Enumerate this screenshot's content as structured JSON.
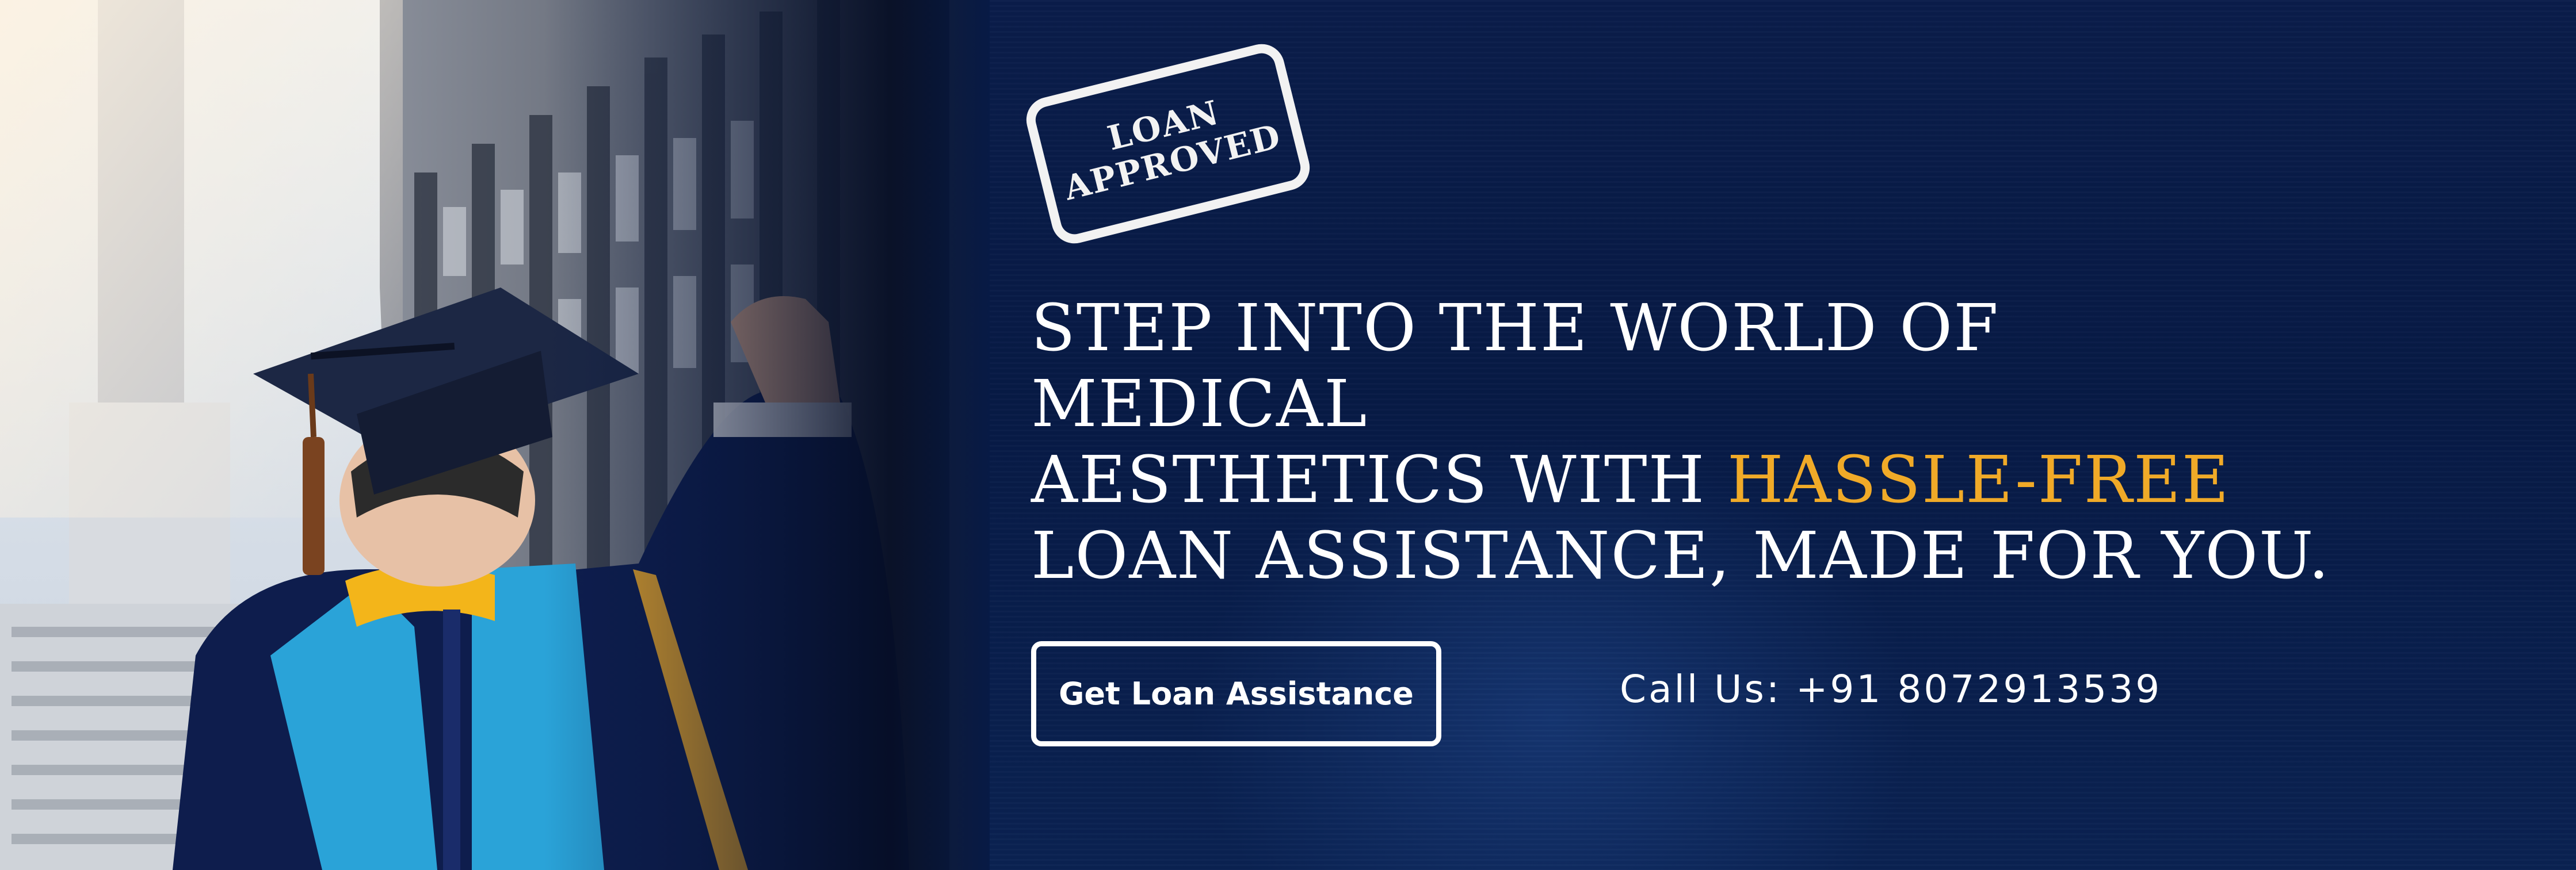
{
  "stamp": {
    "line1": "LOAN",
    "line2": "APPROVED"
  },
  "headline": {
    "line1": "STEP INTO THE WORLD OF MEDICAL",
    "line2_before": "AESTHETICS WITH ",
    "line2_accent": "HASSLE-FREE",
    "line3": "LOAN ASSISTANCE, MADE FOR YOU."
  },
  "cta": {
    "label": "Get Loan Assistance"
  },
  "contact": {
    "phone": "Call Us: +91 8072913539"
  },
  "colors": {
    "background": "#071a45",
    "accent": "#f0aa28",
    "text": "#ffffff"
  }
}
